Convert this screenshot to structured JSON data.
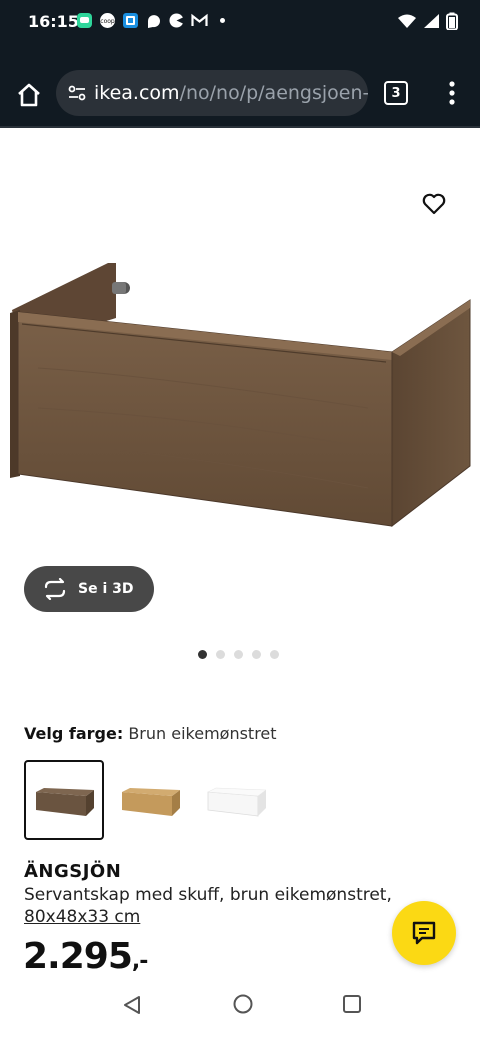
{
  "status_bar": {
    "time": "16:15",
    "notification_icons": [
      "messages-icon",
      "coop-icon",
      "app-icon",
      "chat-bubble-icon",
      "pac-icon",
      "gmail-icon",
      "more-dot-icon"
    ],
    "system_icons": [
      "wifi-icon",
      "signal-icon",
      "battery-icon"
    ]
  },
  "browser": {
    "url_host": "ikea.com",
    "url_path": "/no/no/p/aengsjoen-se",
    "tab_count": "3"
  },
  "product": {
    "view_3d_label": "Se i 3D",
    "carousel": {
      "total": 5,
      "active": 1
    },
    "color_label": "Velg farge:",
    "color_value": "Brun eikemønstret",
    "swatches": [
      {
        "name": "brown-oak",
        "color": "#6a5440",
        "selected": true
      },
      {
        "name": "oak",
        "color": "#c49a5c",
        "selected": false
      },
      {
        "name": "white",
        "color": "#f5f5f5",
        "selected": false
      }
    ],
    "name": "ÄNGSJÖN",
    "description": "Servantskap med skuff, brun eikemønstret,",
    "dimensions": "80x48x33 cm",
    "price": "2.295",
    "price_suffix": ",-"
  },
  "colors": {
    "chrome_bg": "#111a22",
    "chat_button": "#fbd914",
    "view3d_bg": "#484848"
  }
}
